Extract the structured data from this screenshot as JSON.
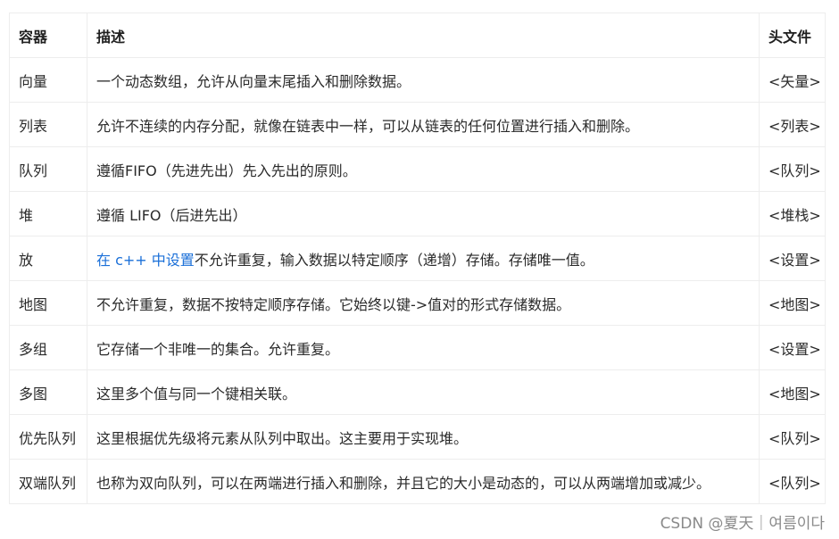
{
  "table": {
    "headers": [
      "容器",
      "描述",
      "头文件"
    ],
    "rows": [
      {
        "container": "向量",
        "description": "一个动态数组，允许从向量末尾插入和删除数据。",
        "header": "<矢量>"
      },
      {
        "container": "列表",
        "description": "允许不连续的内存分配，就像在链表中一样，可以从链表的任何位置进行插入和删除。",
        "header": "<列表>"
      },
      {
        "container": "队列",
        "description": "遵循FIFO（先进先出）先入先出的原则。",
        "header": "<队列>"
      },
      {
        "container": "堆",
        "description": "遵循 LIFO（后进先出）",
        "header": "<堆栈>"
      },
      {
        "container": "放",
        "link": "在 c++ 中设置",
        "description": "不允许重复，输入数据以特定顺序（递增）存储。存储唯一值。",
        "header": "<设置>"
      },
      {
        "container": "地图",
        "description": "不允许重复，数据不按特定顺序存储。它始终以键->值对的形式存储数据。",
        "header": "<地图>"
      },
      {
        "container": "多组",
        "description": "它存储一个非唯一的集合。允许重复。",
        "header": "<设置>"
      },
      {
        "container": "多图",
        "description": "这里多个值与同一个键相关联。",
        "header": "<地图>"
      },
      {
        "container": "优先队列",
        "description": "这里根据优先级将元素从队列中取出。这主要用于实现堆。",
        "header": "<队列>"
      },
      {
        "container": "双端队列",
        "description": "也称为双向队列，可以在两端进行插入和删除，并且它的大小是动态的，可以从两端增加或减少。",
        "header": "<队列>"
      }
    ]
  },
  "watermark": "CSDN @夏天｜여름이다",
  "colors": {
    "link": "#1a6fd8",
    "border": "#ededed",
    "watermark": "#8a8a8a"
  }
}
